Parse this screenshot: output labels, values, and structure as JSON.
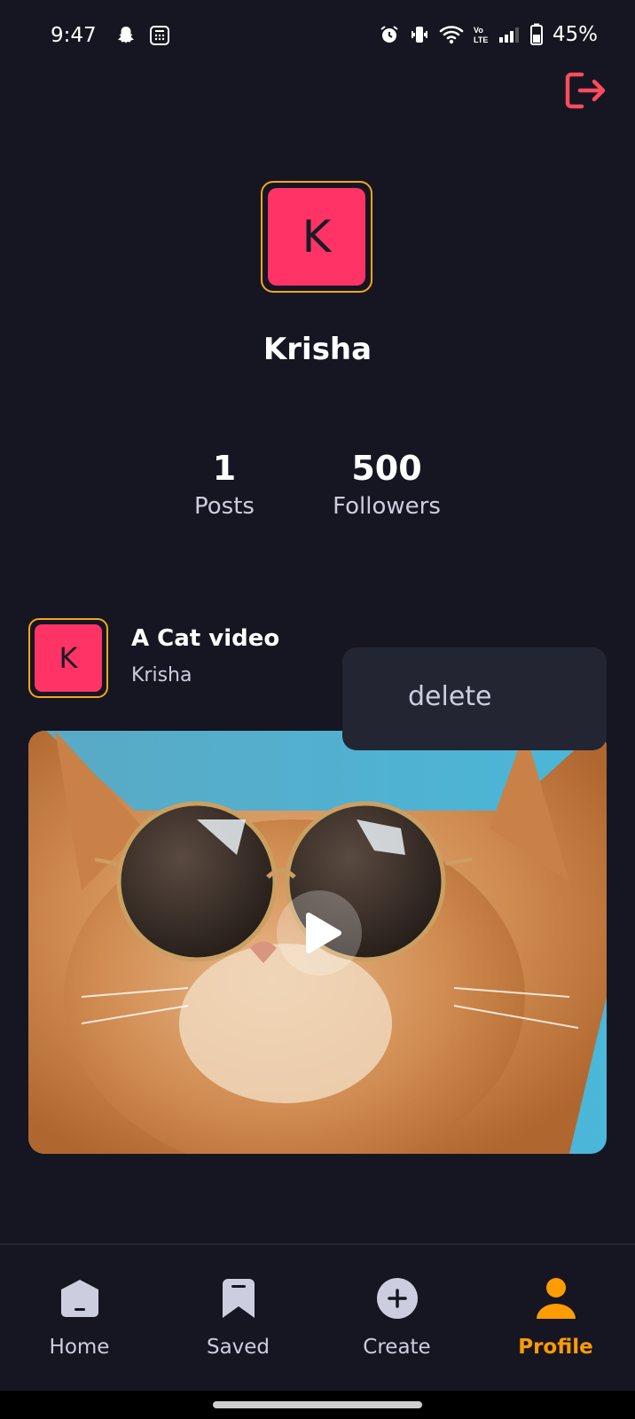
{
  "status_bar": {
    "time": "9:47",
    "battery": "45%"
  },
  "profile": {
    "initial": "K",
    "name": "Krisha"
  },
  "stats": {
    "posts": {
      "value": "1",
      "label": "Posts"
    },
    "followers": {
      "value": "500",
      "label": "Followers"
    }
  },
  "post": {
    "initial": "K",
    "title": "A Cat video",
    "author": "Krisha"
  },
  "menu": {
    "delete_label": "delete"
  },
  "tabs": [
    {
      "label": "Home",
      "icon": "home-icon"
    },
    {
      "label": "Saved",
      "icon": "bookmark-icon"
    },
    {
      "label": "Create",
      "icon": "plus-circle-icon"
    },
    {
      "label": "Profile",
      "icon": "person-icon",
      "active": true
    }
  ],
  "colors": {
    "background": "#161622",
    "accent": "#ff9c01",
    "avatar": "#ff3366",
    "logout": "#ff4b5c"
  }
}
